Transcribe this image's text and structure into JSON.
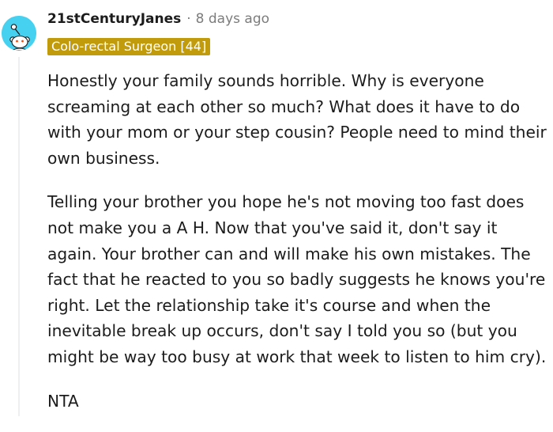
{
  "comment": {
    "author": "21stCenturyJanes",
    "separator": "·",
    "timestamp": "8 days ago",
    "flair": "Colo-rectal Surgeon [44]",
    "paragraphs": [
      "Honestly your family sounds horrible. Why is everyone screaming at each other so much? What does it have to do with your mom or your step cousin? People need to mind their own business.",
      "Telling your brother you hope he's not moving too fast does not make you a A H. Now that you've said it, don't say it again. Your brother can and will make his own mistakes. The fact that he reacted to you so badly suggests he knows you're right. Let the relationship take it's course and when the inevitable break up occurs, don't say I told you so (but you might be way too busy at work that week to listen to him cry).",
      "NTA"
    ]
  },
  "colors": {
    "avatar_background": "#46d1f0",
    "flair_background": "#c29b0c",
    "meta_text": "#7c7c7c",
    "body_text": "#1c1c1c"
  },
  "icons": {
    "avatar": "snoo-avatar-icon"
  }
}
